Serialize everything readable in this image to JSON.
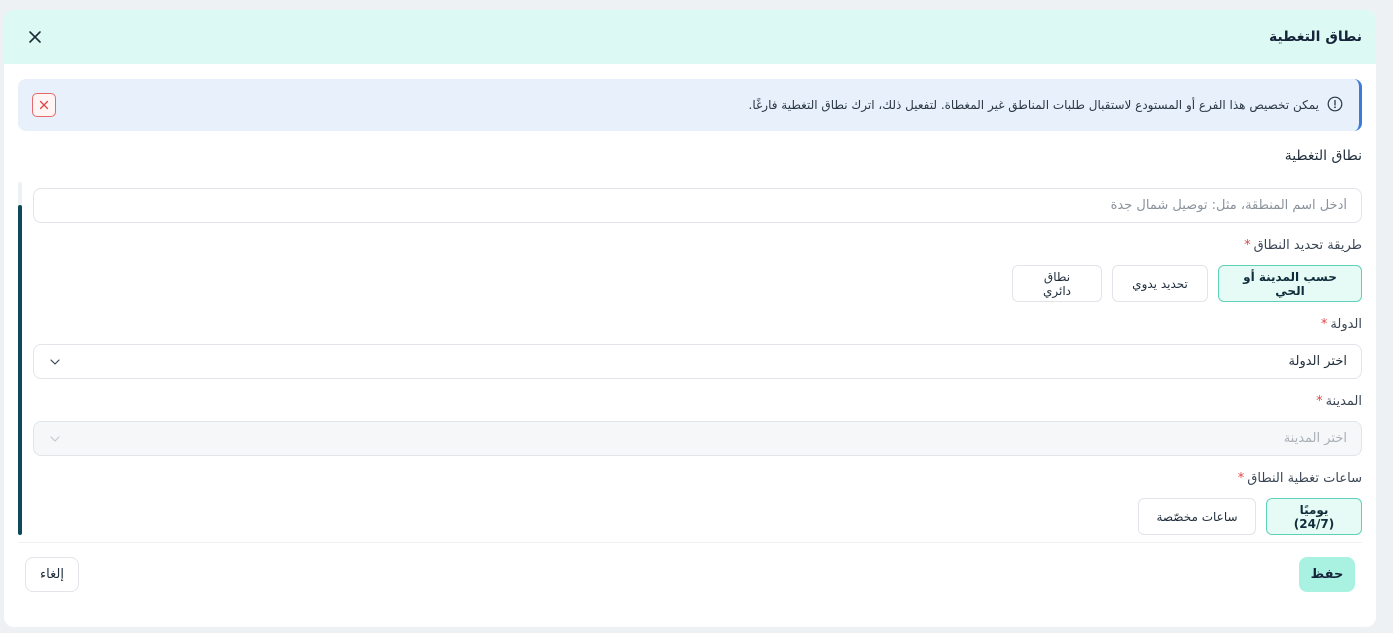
{
  "modal": {
    "title": "نطاق التغطية"
  },
  "alert": {
    "message": "يمكن تخصيص هذا الفرع أو المستودع لاستقبال طلبات المناطق غير المغطاة. لتفعيل ذلك، اترك نطاق التغطية فارغًا."
  },
  "form": {
    "section_title": "نطاق التغطية",
    "zone_name": {
      "value": "",
      "placeholder": "أدخل اسم المنطقة، مثل: توصيل شمال جدة"
    },
    "method": {
      "label": "طريقة تحديد النطاق",
      "required_mark": "*",
      "options": [
        {
          "label": "حسب المدينة أو الحي",
          "selected": true
        },
        {
          "label": "تحديد يدوي",
          "selected": false
        },
        {
          "label": "نطاق دائري",
          "selected": false
        }
      ]
    },
    "country": {
      "label": "الدولة",
      "required_mark": "*",
      "selected_text": "اختر الدولة"
    },
    "city": {
      "label": "المدينة",
      "required_mark": "*",
      "selected_text": "اختر المدينة",
      "disabled": true
    },
    "hours": {
      "label": "ساعات تغطية النطاق",
      "required_mark": "*",
      "options": [
        {
          "label": "يوميًا (24/7)",
          "selected": true
        },
        {
          "label": "ساعات مخصّصة",
          "selected": false
        }
      ]
    }
  },
  "footer": {
    "save_label": "حفظ",
    "cancel_label": "إلغاء"
  },
  "colors": {
    "header_bg": "#dcfaf3",
    "alert_bg": "#e7f0fb",
    "alert_accent": "#3d7bd9",
    "selected_bg": "#e6fbf6",
    "selected_border": "#5fd1b8",
    "save_bg": "#a9f1e1",
    "required": "#e04646",
    "scroll_thumb": "#0f4a5a"
  },
  "icons": {
    "close": "close-icon",
    "info": "info-circle-icon",
    "alert_dismiss": "x-icon",
    "dropdown": "chevron-down-icon"
  }
}
